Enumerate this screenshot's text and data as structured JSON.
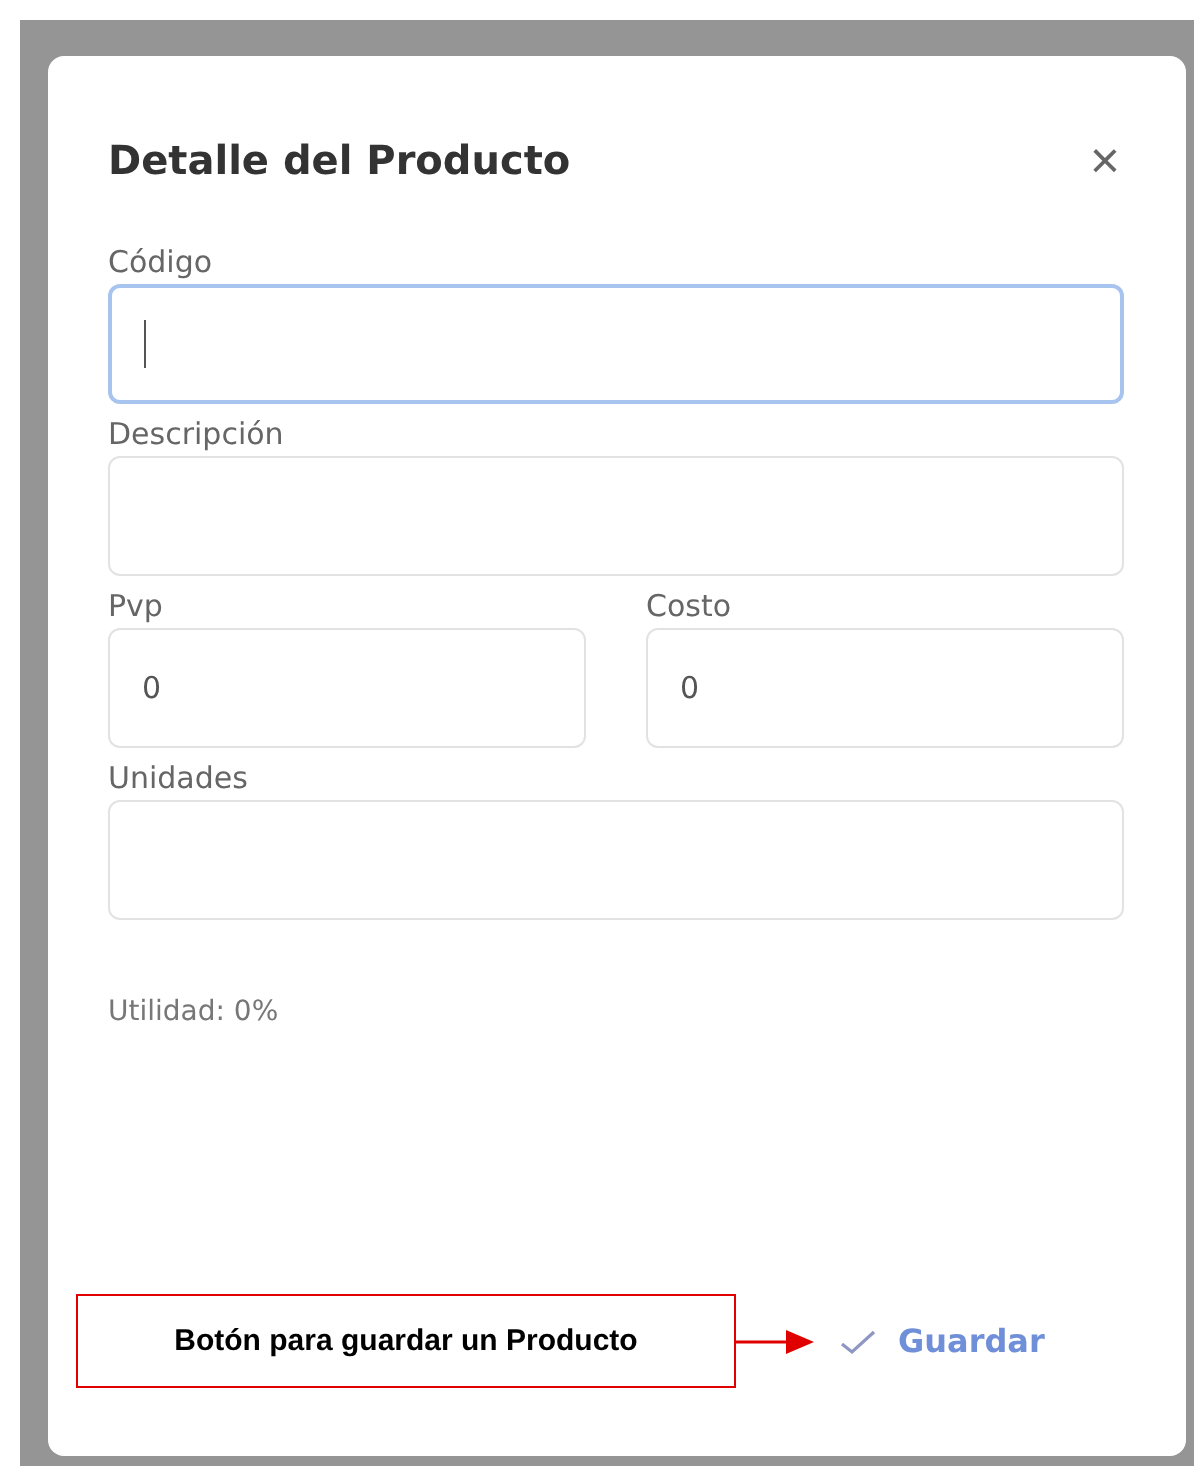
{
  "dialog": {
    "title": "Detalle del Producto",
    "close_glyph": "×"
  },
  "fields": [
    {
      "label": "Código",
      "focused": true,
      "kind": "full"
    },
    {
      "label": "Descripción",
      "focused": false,
      "kind": "full"
    },
    {
      "label": "Pvp",
      "value": "0",
      "focused": false,
      "kind": "half"
    },
    {
      "label": "Costo",
      "value": "0",
      "focused": false,
      "kind": "half"
    },
    {
      "label": "Unidades",
      "focused": false,
      "kind": "full"
    }
  ],
  "summary": "Utilidad: 0%",
  "annotation": {
    "text": "Botón para guardar un Producto"
  },
  "save_button": {
    "label": "Guardar"
  }
}
